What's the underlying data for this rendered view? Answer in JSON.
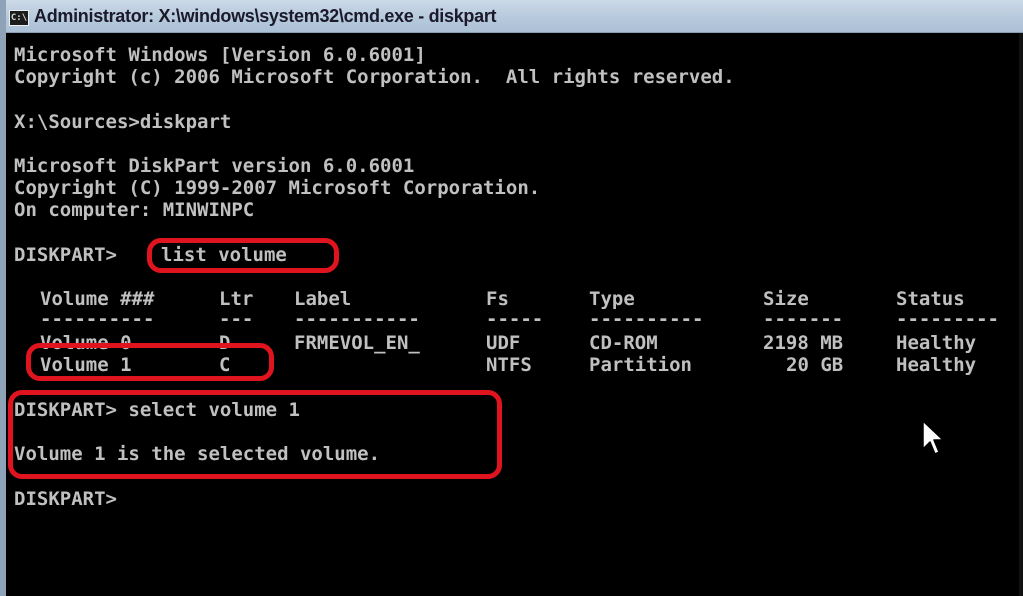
{
  "window": {
    "title": "Administrator: X:\\windows\\system32\\cmd.exe - diskpart",
    "icon_label": "C:\\"
  },
  "console": {
    "line_01": "Microsoft Windows [Version 6.0.6001]",
    "line_02": "Copyright (c) 2006 Microsoft Corporation.  All rights reserved.",
    "line_03": "X:\\Sources>diskpart",
    "line_04": "Microsoft DiskPart version 6.0.6001",
    "line_05": "Copyright (C) 1999-2007 Microsoft Corporation.",
    "line_06": "On computer: MINWINPC",
    "prompt_1": "DISKPART>",
    "command_1": "list volume",
    "table": {
      "headers": [
        "Volume ###",
        "Ltr",
        "Label",
        "Fs",
        "Type",
        "Size",
        "Status"
      ],
      "separators": [
        "----------",
        "---",
        "-----------",
        "-----",
        "----------",
        "-------",
        "---------"
      ],
      "rows": [
        [
          "Volume 0",
          "D",
          "FRMEVOL_EN_",
          "UDF",
          "CD-ROM",
          "2198 MB",
          "Healthy"
        ],
        [
          "Volume 1",
          "C",
          "",
          "NTFS",
          "Partition",
          "20 GB",
          "Healthy"
        ]
      ]
    },
    "prompt_2": "DISKPART> select volume 1",
    "result": "Volume 1 is the selected volume.",
    "prompt_3": "DISKPART>"
  },
  "colors": {
    "console_bg": "#000000",
    "console_fg": "#c0c0c0",
    "highlight": "#e0141e",
    "titlebar": "#b5c8dc"
  },
  "icons": {
    "app": "cmd-icon",
    "pointer": "mouse-pointer-icon"
  }
}
